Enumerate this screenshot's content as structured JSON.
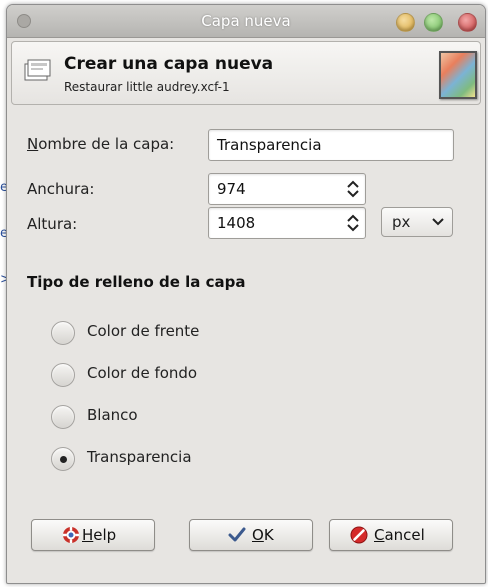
{
  "window": {
    "title": "Capa nueva"
  },
  "header": {
    "title": "Crear una capa nueva",
    "subtitle": "Restaurar little audrey.xcf-1"
  },
  "form": {
    "name_label": "Nombre de la capa:",
    "name_value": "Transparencia",
    "width_label": "Anchura:",
    "width_value": "974",
    "height_label": "Altura:",
    "height_value": "1408",
    "unit_value": "px"
  },
  "fill": {
    "section_title": "Tipo de relleno de la capa",
    "options": [
      {
        "label": "Color de frente",
        "selected": false
      },
      {
        "label": "Color de fondo",
        "selected": false
      },
      {
        "label": "Blanco",
        "selected": false
      },
      {
        "label": "Transparencia",
        "selected": true
      }
    ]
  },
  "buttons": {
    "help": "Help",
    "ok": "OK",
    "cancel": "Cancel"
  },
  "background_fragments": [
    "e",
    "e",
    ">"
  ],
  "icons": {
    "window_app": "app-icon",
    "header": "layer-icon",
    "thumbnail": "image-thumbnail",
    "help": "help-icon",
    "ok": "checkmark-icon",
    "cancel": "cancel-icon"
  }
}
